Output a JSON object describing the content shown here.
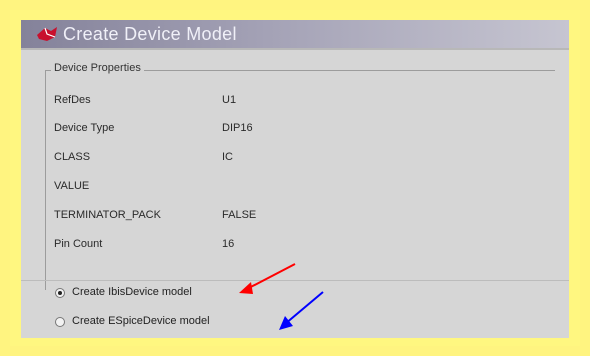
{
  "window": {
    "title": "Create Device Model",
    "icon": "app-icon"
  },
  "group": {
    "legend": "Device Properties"
  },
  "properties": [
    {
      "key": "RefDes",
      "value": "U1"
    },
    {
      "key": "Device Type",
      "value": "DIP16"
    },
    {
      "key": "CLASS",
      "value": "IC"
    },
    {
      "key": "VALUE",
      "value": ""
    },
    {
      "key": "TERMINATOR_PACK",
      "value": "FALSE"
    },
    {
      "key": "Pin Count",
      "value": "16"
    }
  ],
  "options": [
    {
      "label": "Create IbisDevice model",
      "checked": true
    },
    {
      "label": "Create ESpiceDevice model",
      "checked": false
    }
  ],
  "annotations": {
    "arrow1_color": "#ff0000",
    "arrow2_color": "#0000ff"
  },
  "colors": {
    "page_background": "#fff480",
    "dialog_background": "#d6d6d6",
    "titlebar_start": "#84829a",
    "titlebar_end": "#c6c5d1"
  }
}
